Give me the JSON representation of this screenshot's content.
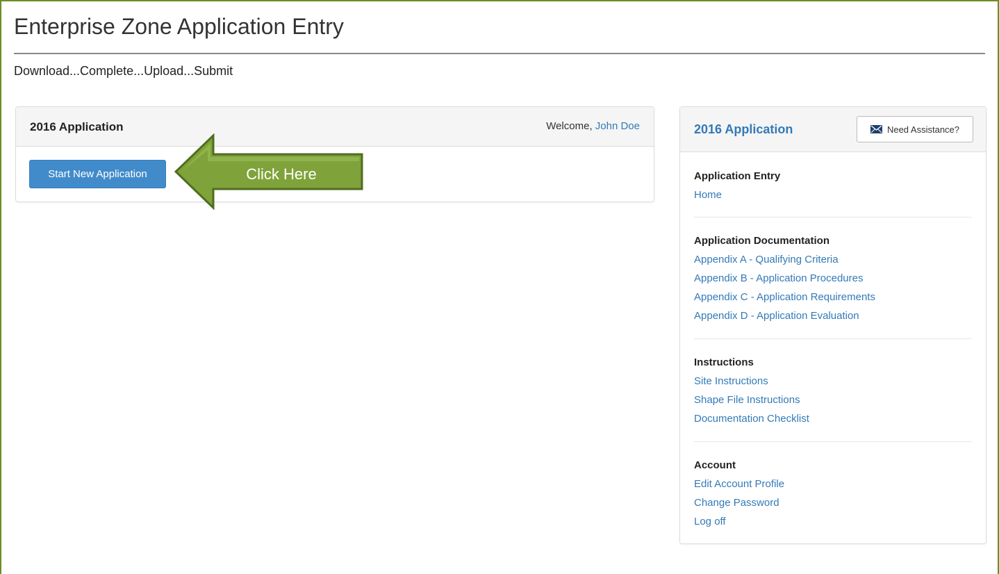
{
  "page": {
    "title": "Enterprise Zone Application Entry",
    "tagline": "Download...Complete...Upload...Submit"
  },
  "left_panel": {
    "title": "2016 Application",
    "welcome_prefix": "Welcome, ",
    "user_name": "John Doe",
    "start_button": "Start New Application"
  },
  "callout": {
    "text": "Click Here",
    "color": "#7fa33a"
  },
  "right_panel": {
    "title": "2016 Application",
    "assist_button": "Need Assistance?",
    "assist_icon": "mail-icon",
    "sections": [
      {
        "heading": "Application Entry",
        "links": [
          "Home"
        ]
      },
      {
        "heading": "Application Documentation",
        "links": [
          "Appendix A - Qualifying Criteria",
          "Appendix B - Application Procedures",
          "Appendix C - Application Requirements",
          "Appendix D - Application Evaluation"
        ]
      },
      {
        "heading": "Instructions",
        "links": [
          "Site Instructions",
          "Shape File Instructions",
          "Documentation Checklist"
        ]
      },
      {
        "heading": "Account",
        "links": [
          "Edit Account Profile",
          "Change Password",
          "Log off"
        ]
      }
    ]
  },
  "colors": {
    "link": "#337ab7",
    "primary_button": "#428bca",
    "page_border": "#6b8e23"
  }
}
